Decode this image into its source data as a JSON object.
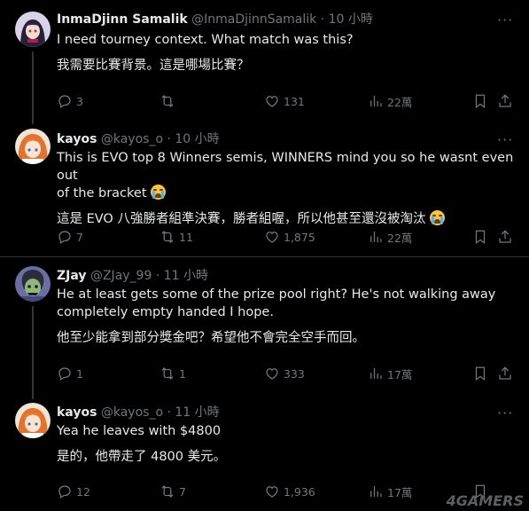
{
  "tweets": [
    {
      "name": "InmaDjinn Samalik",
      "handle": "@InmaDjinnSamalik",
      "time": "· 10 小時",
      "lines": [
        "I need tourney context. What match was this?",
        "我需要比賽背景。這是哪場比賽？"
      ],
      "replies": "3",
      "retweets": "",
      "likes": "131",
      "views": "22萬"
    },
    {
      "name": "kayos",
      "handle": "@kayos_o",
      "time": "· 10 小時",
      "lines": [
        "This is EVO top 8 Winners semis, WINNERS mind you so he wasnt even out",
        "of the bracket",
        "這是 EVO 八強勝者組準決賽，勝者組喔，所以他甚至還沒被淘汰"
      ],
      "replies": "7",
      "retweets": "11",
      "likes": "1,875",
      "views": "22萬"
    },
    {
      "name": "ZJay",
      "handle": "@ZJay_99",
      "time": "· 11 小時",
      "lines": [
        "He at least gets some of the prize pool right? He's not walking away",
        "completely empty handed I hope.",
        "他至少能拿到部分獎金吧？希望他不會完全空手而回。"
      ],
      "replies": "1",
      "retweets": "1",
      "likes": "333",
      "views": "17萬"
    },
    {
      "name": "kayos",
      "handle": "@kayos_o",
      "time": "· 11 小時",
      "lines": [
        "Yea he leaves with $4800",
        "是的，他帶走了 4800 美元。"
      ],
      "replies": "12",
      "retweets": "7",
      "likes": "1,936",
      "views": "17萬"
    }
  ],
  "more_glyph": "···",
  "watermark": "4GAMERS",
  "colors": {
    "background": "#000000",
    "text": "#e7e9ea",
    "muted": "#71767b",
    "line": "#333639"
  },
  "icons": [
    "reply-icon",
    "retweet-icon",
    "like-icon",
    "views-icon",
    "bookmark-icon",
    "share-icon",
    "more-icon"
  ]
}
